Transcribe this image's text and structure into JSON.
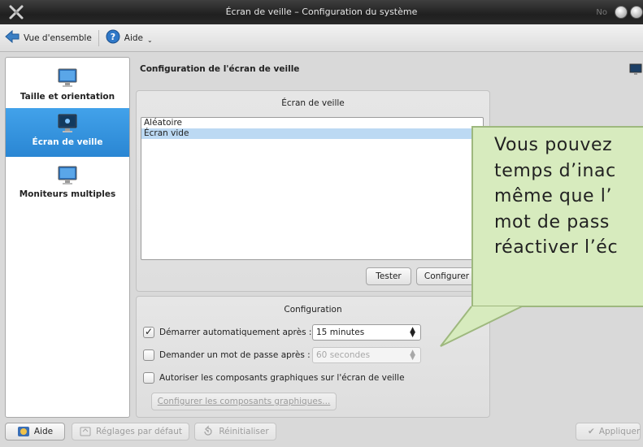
{
  "window": {
    "title": "Écran de veille – Configuration du système",
    "ghost_text": "No"
  },
  "toolbar": {
    "overview_label": "Vue d'ensemble",
    "help_label": "Aide"
  },
  "sidebar": {
    "items": [
      {
        "label": "Taille et orientation",
        "active": false
      },
      {
        "label": "Écran de veille",
        "active": true
      },
      {
        "label": "Moniteurs multiples",
        "active": false
      }
    ]
  },
  "main": {
    "title": "Configuration de l'écran de veille",
    "screensaver_group": {
      "title": "Écran de veille",
      "options": [
        "Aléatoire",
        "Écran vide"
      ],
      "selected": "Écran vide",
      "test_button": "Tester",
      "configure_button": "Configurer"
    },
    "config_group": {
      "title": "Configuration",
      "auto_start": {
        "label": "Démarrer automatiquement après :",
        "checked": true,
        "value": "15 minutes"
      },
      "password": {
        "label": "Demander un mot de passe après :",
        "checked": false,
        "value": "60 secondes"
      },
      "widgets": {
        "label": "Autoriser les composants graphiques sur l'écran de veille",
        "checked": false
      },
      "configure_widgets_button": "Configurer les composants graphiques..."
    }
  },
  "callout": {
    "lines": [
      "Vous pouvez",
      "temps d’inac",
      "même que l’",
      "mot de pass",
      "réactiver l’éc"
    ],
    "fill_color": "#d7ebbe"
  },
  "bottom": {
    "help_button": "Aide",
    "defaults_button": "Réglages par défaut",
    "reset_button": "Réinitialiser",
    "apply_button": "Appliquer"
  },
  "colors": {
    "accent": "#2a86d3",
    "selection": "#bcd9f3"
  }
}
